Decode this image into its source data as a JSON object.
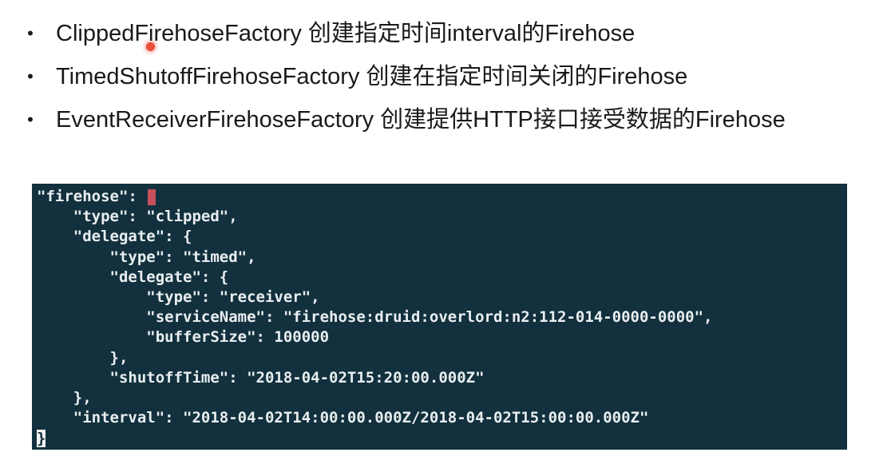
{
  "bullets": [
    {
      "text": "ClippedFirehoseFactory 创建指定时间interval的Firehose"
    },
    {
      "text": "TimedShutoffFirehoseFactory 创建在指定时间关闭的Firehose"
    },
    {
      "text": "EventReceiverFirehoseFactory 创建提供HTTP接口接受数据的Firehose"
    }
  ],
  "bullet_symbol": "•",
  "terminal": {
    "background": "#12303d",
    "lines": [
      "\"firehose\": ",
      "    \"type\": \"clipped\",",
      "    \"delegate\": {",
      "        \"type\": \"timed\",",
      "        \"delegate\": {",
      "            \"type\": \"receiver\",",
      "            \"serviceName\": \"firehose:druid:overlord:n2:112-014-0000-0000\",",
      "            \"bufferSize\": 100000",
      "        },",
      "        \"shutoffTime\": \"2018-04-02T15:20:00.000Z\"",
      "    },",
      "    \"interval\": \"2018-04-02T14:00:00.000Z/2018-04-02T15:00:00.000Z\""
    ],
    "last_line_cursor": "}"
  },
  "laser_pointer_color": "#e8503a"
}
